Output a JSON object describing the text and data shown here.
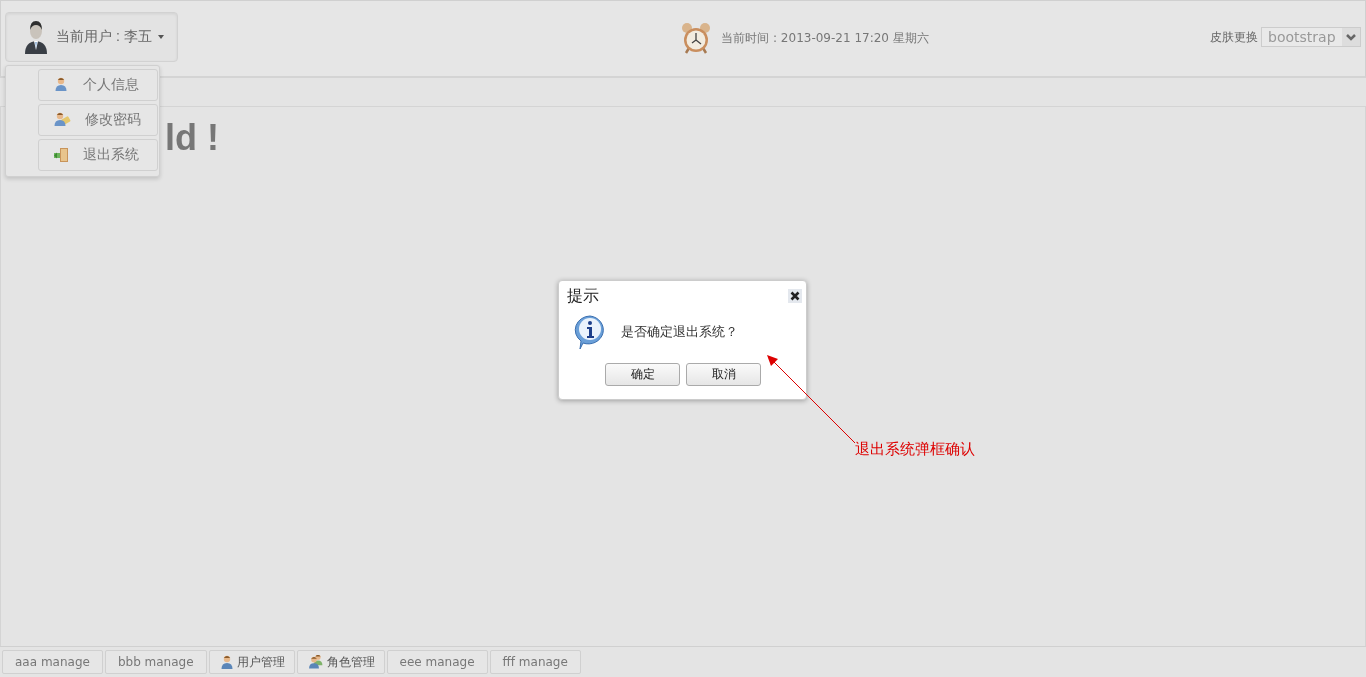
{
  "header": {
    "user_menu": {
      "label": "当前用户 : 李五",
      "expanded": true,
      "items": [
        {
          "kind": "profile",
          "label": "个人信息"
        },
        {
          "kind": "password",
          "label": "修改密码"
        },
        {
          "kind": "logout",
          "label": "退出系统"
        }
      ]
    },
    "clock": {
      "label": "当前时间 : 2013-09-21 17:20 星期六"
    },
    "skin": {
      "label": "皮肤更换",
      "value": "bootstrap"
    }
  },
  "heading": "ld !",
  "dialog": {
    "title": "提示",
    "message": "是否确定退出系统？",
    "buttons": [
      "确定",
      "取消"
    ]
  },
  "annotation": {
    "text": "退出系统弹框确认"
  },
  "taskbar": [
    {
      "kind": "text",
      "label": "aaa manage"
    },
    {
      "kind": "text",
      "label": "bbb manage"
    },
    {
      "kind": "user",
      "label": "用户管理"
    },
    {
      "kind": "group",
      "label": "角色管理"
    },
    {
      "kind": "text",
      "label": "eee manage"
    },
    {
      "kind": "text",
      "label": "fff manage"
    }
  ]
}
